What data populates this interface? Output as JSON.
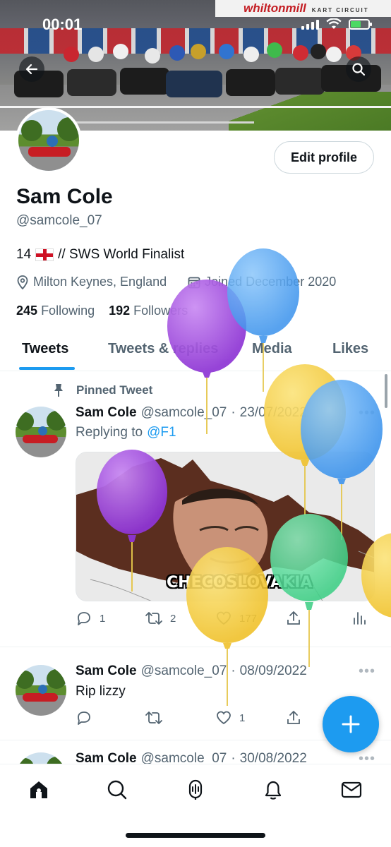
{
  "status_bar": {
    "time": "00:01"
  },
  "banner": {
    "sign_text": "whiltonmill",
    "sign_sub": "KART CIRCUIT"
  },
  "profile": {
    "edit_label": "Edit profile",
    "name": "Sam Cole",
    "handle": "@samcole_07",
    "bio_prefix": "14",
    "bio_suffix": "// SWS World Finalist",
    "location": "Milton Keynes, England",
    "joined": "Joined December 2020",
    "following_count": "245",
    "following_label": "Following",
    "followers_count": "192",
    "followers_label": "Followers"
  },
  "tabs": [
    {
      "label": "Tweets",
      "active": true
    },
    {
      "label": "Tweets & replies",
      "active": false
    },
    {
      "label": "Media",
      "active": false
    },
    {
      "label": "Likes",
      "active": false
    }
  ],
  "tweets": [
    {
      "pinned_label": "Pinned Tweet",
      "name": "Sam Cole",
      "handle": "@samcole_07",
      "sep": "·",
      "date": "23/07/2022",
      "replying_prefix": "Replying to",
      "replying_to": "@F1",
      "media_caption": "CHECOSLOVAKIA",
      "replies": "1",
      "retweets": "2",
      "likes": "177"
    },
    {
      "name": "Sam Cole",
      "handle": "@samcole_07",
      "sep": "·",
      "date": "08/09/2022",
      "text": "Rip lizzy",
      "likes": "1"
    },
    {
      "name": "Sam Cole",
      "handle": "@samcole_07",
      "sep": "·",
      "date": "30/08/2022"
    }
  ],
  "colors": {
    "accent": "#1d9bf0",
    "text_primary": "#0f1419",
    "text_secondary": "#536471",
    "balloon_purple": "#a24de0",
    "balloon_blue": "#4aa3f5",
    "balloon_yellow": "#f5cf3f",
    "balloon_green": "#58d89a"
  }
}
